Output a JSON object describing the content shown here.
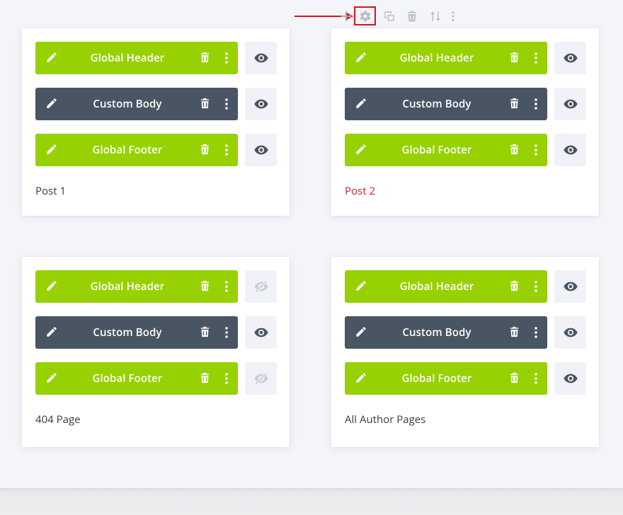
{
  "toolbar": {
    "icons": [
      "move-icon",
      "gear-icon",
      "duplicate-icon",
      "trash-icon",
      "sort-icon",
      "more-icon"
    ],
    "highlighted": "gear-icon",
    "highlight_color": "#d8141c"
  },
  "colors": {
    "global": "#97d102",
    "custom": "#4a5563",
    "active_title": "#c0282d"
  },
  "templates": [
    {
      "title": "Post 1",
      "active": false,
      "rows": [
        {
          "label": "Global Header",
          "kind": "global",
          "visible": true
        },
        {
          "label": "Custom Body",
          "kind": "custom",
          "visible": true
        },
        {
          "label": "Global Footer",
          "kind": "global",
          "visible": true
        }
      ]
    },
    {
      "title": "Post 2",
      "active": true,
      "rows": [
        {
          "label": "Global Header",
          "kind": "global",
          "visible": true
        },
        {
          "label": "Custom Body",
          "kind": "custom",
          "visible": true
        },
        {
          "label": "Global Footer",
          "kind": "global",
          "visible": true
        }
      ]
    },
    {
      "title": "404 Page",
      "active": false,
      "rows": [
        {
          "label": "Global Header",
          "kind": "global",
          "visible": false
        },
        {
          "label": "Custom Body",
          "kind": "custom",
          "visible": true
        },
        {
          "label": "Global Footer",
          "kind": "global",
          "visible": false
        }
      ]
    },
    {
      "title": "All Author Pages",
      "active": false,
      "rows": [
        {
          "label": "Global Header",
          "kind": "global",
          "visible": true
        },
        {
          "label": "Custom Body",
          "kind": "custom",
          "visible": true
        },
        {
          "label": "Global Footer",
          "kind": "global",
          "visible": true
        }
      ]
    }
  ]
}
